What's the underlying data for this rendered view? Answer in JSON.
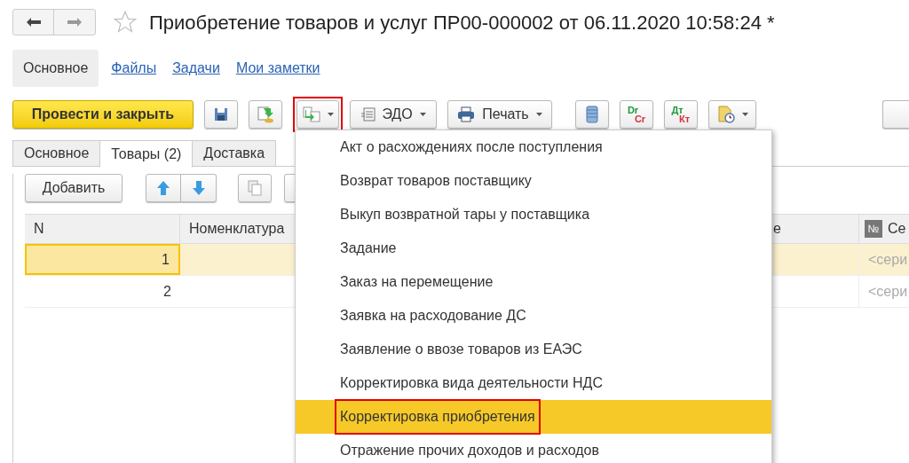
{
  "window": {
    "title": "Приобретение товаров и услуг ПР00-000002 от 06.11.2020 10:58:24 *",
    "favorite": false
  },
  "nav_tabs": [
    {
      "label": "Основное",
      "selected": true
    },
    {
      "label": "Файлы",
      "selected": false
    },
    {
      "label": "Задачи",
      "selected": false
    },
    {
      "label": "Мои заметки",
      "selected": false
    }
  ],
  "toolbar": {
    "post_and_close": "Провести и закрыть",
    "create_based_on_highlighted": true,
    "edo": "ЭДО",
    "print": "Печать",
    "dr": "Dr",
    "cr": "Cr",
    "dt": "Дт",
    "kt": "Кт"
  },
  "form_tabs": [
    {
      "label": "Основное",
      "selected": false
    },
    {
      "label": "Товары (2)",
      "selected": true
    },
    {
      "label": "Доставка",
      "selected": false
    }
  ],
  "table_toolbar": {
    "add": "Добавить"
  },
  "table": {
    "columns": [
      "N",
      "Номенклатура",
      "е",
      "Се"
    ],
    "column_4_sign": "№",
    "rows": [
      {
        "n": "1",
        "column_4": "<сери",
        "selected": true
      },
      {
        "n": "2",
        "column_4": "<сери",
        "selected": false
      }
    ]
  },
  "menu": {
    "items": [
      {
        "label": "Акт о расхождениях после поступления",
        "selected": false,
        "highlighted": false
      },
      {
        "label": "Возврат товаров поставщику",
        "selected": false,
        "highlighted": false
      },
      {
        "label": "Выкуп возвратной тары у поставщика",
        "selected": false,
        "highlighted": false
      },
      {
        "label": "Задание",
        "selected": false,
        "highlighted": false
      },
      {
        "label": "Заказ на перемещение",
        "selected": false,
        "highlighted": false
      },
      {
        "label": "Заявка на расходование ДС",
        "selected": false,
        "highlighted": false
      },
      {
        "label": "Заявление о ввозе товаров из ЕАЭС",
        "selected": false,
        "highlighted": false
      },
      {
        "label": "Корректировка вида деятельности НДС",
        "selected": false,
        "highlighted": false
      },
      {
        "label": "Корректировка приобретения",
        "selected": true,
        "highlighted": true
      },
      {
        "label": "Отражение прочих доходов и расходов",
        "selected": false,
        "highlighted": false
      }
    ]
  }
}
